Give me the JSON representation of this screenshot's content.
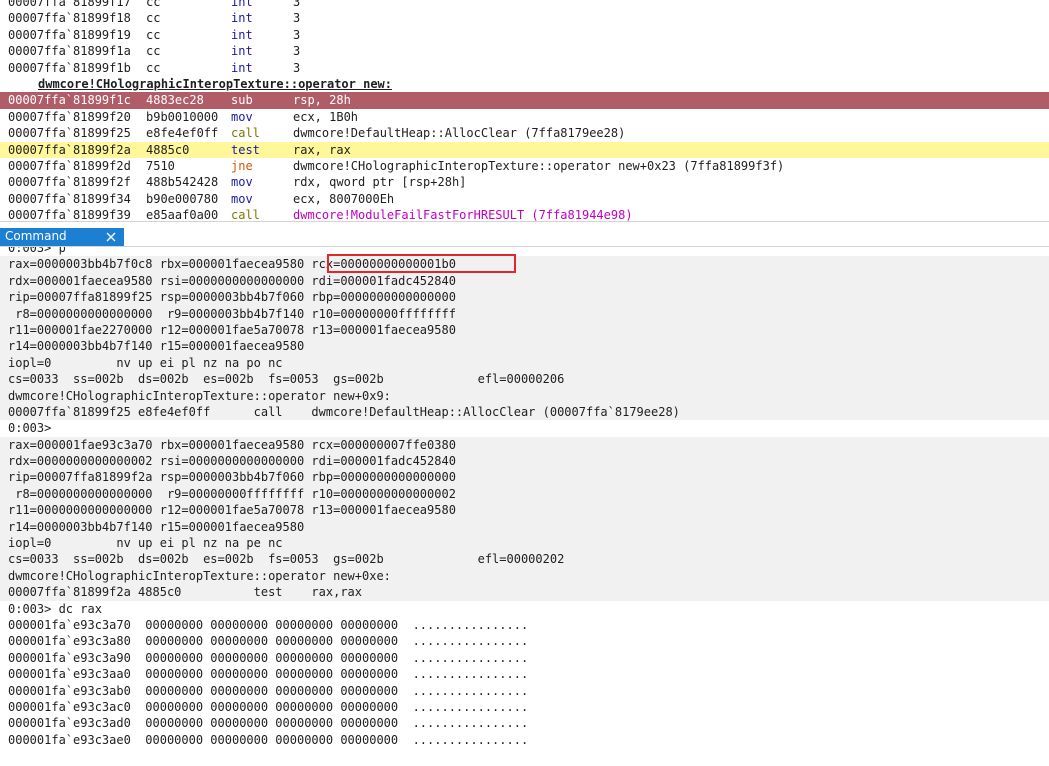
{
  "disassembly": {
    "lines": [
      {
        "kind": "code",
        "addr": "00007ffa`81899f17",
        "bytes": "cc",
        "mnemonic": "int",
        "operands": "3",
        "highlight": "none"
      },
      {
        "kind": "code",
        "addr": "00007ffa`81899f18",
        "bytes": "cc",
        "mnemonic": "int",
        "operands": "3",
        "highlight": "none"
      },
      {
        "kind": "code",
        "addr": "00007ffa`81899f19",
        "bytes": "cc",
        "mnemonic": "int",
        "operands": "3",
        "highlight": "none"
      },
      {
        "kind": "code",
        "addr": "00007ffa`81899f1a",
        "bytes": "cc",
        "mnemonic": "int",
        "operands": "3",
        "highlight": "none"
      },
      {
        "kind": "code",
        "addr": "00007ffa`81899f1b",
        "bytes": "cc",
        "mnemonic": "int",
        "operands": "3",
        "highlight": "none"
      },
      {
        "kind": "symbol",
        "text": "dwmcore!CHolographicInteropTexture::operator new:"
      },
      {
        "kind": "code",
        "addr": "00007ffa`81899f1c",
        "bytes": "4883ec28",
        "mnemonic": "sub",
        "operands": "rsp, 28h",
        "highlight": "current"
      },
      {
        "kind": "code",
        "addr": "00007ffa`81899f20",
        "bytes": "b9b0010000",
        "mnemonic": "mov",
        "operands": "ecx, 1B0h",
        "highlight": "none"
      },
      {
        "kind": "code",
        "addr": "00007ffa`81899f25",
        "bytes": "e8fe4ef0ff",
        "mnemonic": "call",
        "operands": "dwmcore!DefaultHeap::AllocClear (7ffa8179ee28)",
        "highlight": "none"
      },
      {
        "kind": "code",
        "addr": "00007ffa`81899f2a",
        "bytes": "4885c0",
        "mnemonic": "test",
        "operands": "rax, rax",
        "highlight": "bp"
      },
      {
        "kind": "code",
        "addr": "00007ffa`81899f2d",
        "bytes": "7510",
        "mnemonic": "jne",
        "operands": "dwmcore!CHolographicInteropTexture::operator new+0x23 (7ffa81899f3f)",
        "highlight": "none"
      },
      {
        "kind": "code",
        "addr": "00007ffa`81899f2f",
        "bytes": "488b542428",
        "mnemonic": "mov",
        "operands": "rdx, qword ptr [rsp+28h]",
        "highlight": "none"
      },
      {
        "kind": "code",
        "addr": "00007ffa`81899f34",
        "bytes": "b90e000780",
        "mnemonic": "mov",
        "operands": "ecx, 8007000Eh",
        "highlight": "none"
      },
      {
        "kind": "code",
        "addr": "00007ffa`81899f39",
        "bytes": "e85aaf0a00",
        "mnemonic": "call",
        "operands": "dwmcore!ModuleFailFastForHRESULT (7ffa81944e98)",
        "highlight": "none"
      }
    ]
  },
  "tab": {
    "label": "Command"
  },
  "command": {
    "lines": [
      {
        "text": "0:003> p",
        "shade": false
      },
      {
        "text": "rax=0000003bb4b7f0c8 rbx=000001faecea9580 rcx=00000000000001b0",
        "shade": true
      },
      {
        "text": "rdx=000001faecea9580 rsi=0000000000000000 rdi=000001fadc452840",
        "shade": true
      },
      {
        "text": "rip=00007ffa81899f25 rsp=0000003bb4b7f060 rbp=0000000000000000",
        "shade": true
      },
      {
        "text": " r8=0000000000000000  r9=0000003bb4b7f140 r10=00000000ffffffff",
        "shade": true
      },
      {
        "text": "r11=000001fae2270000 r12=000001fae5a70078 r13=000001faecea9580",
        "shade": true
      },
      {
        "text": "r14=0000003bb4b7f140 r15=000001faecea9580",
        "shade": true
      },
      {
        "text": "iopl=0         nv up ei pl nz na po nc",
        "shade": true
      },
      {
        "text": "cs=0033  ss=002b  ds=002b  es=002b  fs=0053  gs=002b             efl=00000206",
        "shade": true
      },
      {
        "text": "dwmcore!CHolographicInteropTexture::operator new+0x9:",
        "shade": true
      },
      {
        "text": "00007ffa`81899f25 e8fe4ef0ff      call    dwmcore!DefaultHeap::AllocClear (00007ffa`8179ee28)",
        "shade": true
      },
      {
        "text": "0:003>",
        "shade": false
      },
      {
        "text": "rax=000001fae93c3a70 rbx=000001faecea9580 rcx=000000007ffe0380",
        "shade": true
      },
      {
        "text": "rdx=0000000000000002 rsi=0000000000000000 rdi=000001fadc452840",
        "shade": true
      },
      {
        "text": "rip=00007ffa81899f2a rsp=0000003bb4b7f060 rbp=0000000000000000",
        "shade": true
      },
      {
        "text": " r8=0000000000000000  r9=00000000ffffffff r10=0000000000000002",
        "shade": true
      },
      {
        "text": "r11=0000000000000000 r12=000001fae5a70078 r13=000001faecea9580",
        "shade": true
      },
      {
        "text": "r14=0000003bb4b7f140 r15=000001faecea9580",
        "shade": true
      },
      {
        "text": "iopl=0         nv up ei pl nz na pe nc",
        "shade": true
      },
      {
        "text": "cs=0033  ss=002b  ds=002b  es=002b  fs=0053  gs=002b             efl=00000202",
        "shade": true
      },
      {
        "text": "dwmcore!CHolographicInteropTexture::operator new+0xe:",
        "shade": true
      },
      {
        "text": "00007ffa`81899f2a 4885c0          test    rax,rax",
        "shade": true
      },
      {
        "text": "0:003> dc rax",
        "shade": false
      },
      {
        "text": "000001fa`e93c3a70  00000000 00000000 00000000 00000000  ................",
        "shade": false
      },
      {
        "text": "000001fa`e93c3a80  00000000 00000000 00000000 00000000  ................",
        "shade": false
      },
      {
        "text": "000001fa`e93c3a90  00000000 00000000 00000000 00000000  ................",
        "shade": false
      },
      {
        "text": "000001fa`e93c3aa0  00000000 00000000 00000000 00000000  ................",
        "shade": false
      },
      {
        "text": "000001fa`e93c3ab0  00000000 00000000 00000000 00000000  ................",
        "shade": false
      },
      {
        "text": "000001fa`e93c3ac0  00000000 00000000 00000000 00000000  ................",
        "shade": false
      },
      {
        "text": "000001fa`e93c3ad0  00000000 00000000 00000000 00000000  ................",
        "shade": false
      },
      {
        "text": "000001fa`e93c3ae0  00000000 00000000 00000000 00000000  ................",
        "shade": false
      }
    ]
  },
  "colors": {
    "current_line": "#b15d68",
    "breakpoint_line": "#fff79a",
    "tab_active": "#1d7fd1",
    "annotation_box": "#e2262a"
  }
}
